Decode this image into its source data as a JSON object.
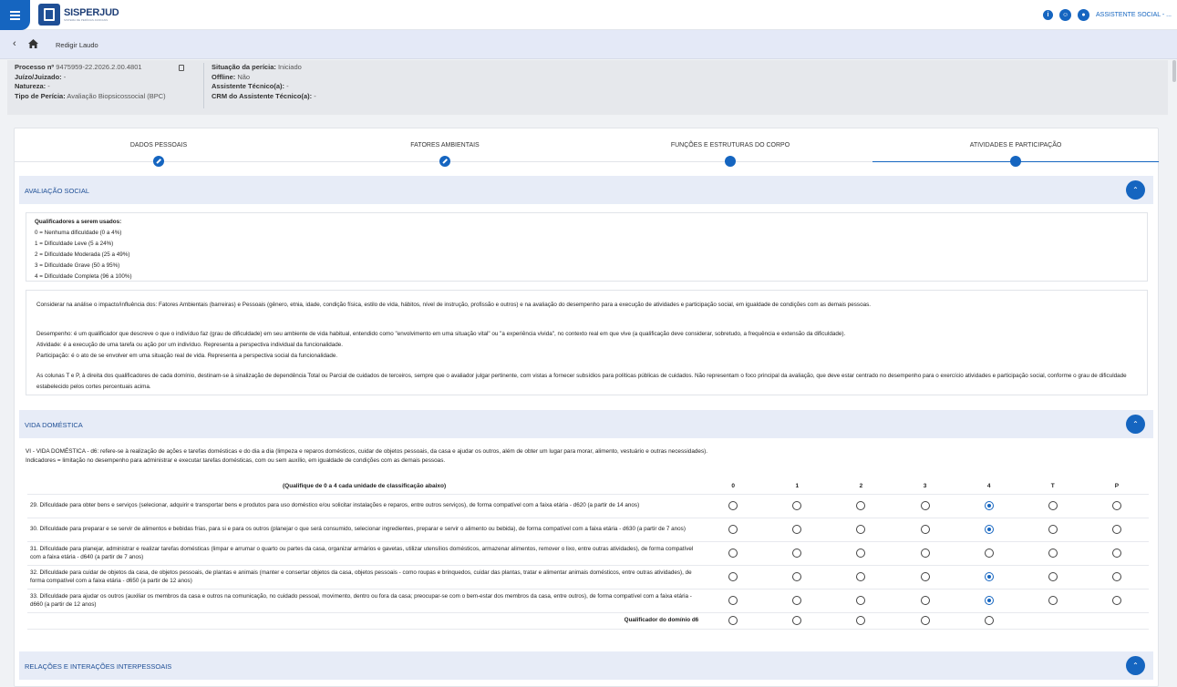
{
  "app": {
    "logo_title": "SISPERJUD",
    "logo_subtitle": "SISTEMA DE PERÍCIAS JUDICIAIS",
    "user": "ASSISTENTE SOCIAL - ..."
  },
  "breadcrumb": {
    "page": "Redigir Laudo"
  },
  "info": {
    "processo_label": "Processo nº",
    "processo_value": "9475959-22.2026.2.00.4801",
    "juizo_label": "Juízo/Juizado:",
    "juizo_value": "-",
    "natureza_label": "Natureza:",
    "natureza_value": "-",
    "tipo_label": "Tipo de Perícia:",
    "tipo_value": "Avaliação Biopsicossocial (BPC)",
    "situacao_label": "Situação da perícia:",
    "situacao_value": "Iniciado",
    "offline_label": "Offline:",
    "offline_value": "Não",
    "assistente_label": "Assistente Técnico(a):",
    "assistente_value": "-",
    "crm_label": "CRM do Assistente Técnico(a):",
    "crm_value": "-"
  },
  "steps": [
    "DADOS PESSOAIS",
    "FATORES AMBIENTAIS",
    "FUNÇÕES E ESTRUTURAS DO CORPO",
    "ATIVIDADES E PARTICIPAÇÃO"
  ],
  "sections": {
    "avaliacao": "AVALIAÇÃO SOCIAL",
    "vida": "VIDA DOMÉSTICA",
    "relacoes": "RELAÇÕES E INTERAÇÕES INTERPESSOAIS"
  },
  "qualificadores": {
    "title": "Qualificadores a serem usados:",
    "items": [
      "0 = Nenhuma dificuldade (0 a 4%)",
      "1 = Dificuldade Leve (5 a 24%)",
      "2 = Dificuldade Moderada (25 a 49%)",
      "3 = Dificuldade Grave (50 a 95%)",
      "4 = Dificuldade Completa (96 a 100%)"
    ]
  },
  "consider": {
    "p1": "Considerar na análise o impacto/influência dos: Fatores Ambientais (barreiras) e Pessoais (gênero, etnia, idade, condição física, estilo de vida, hábitos, nível de instrução, profissão e outros) e na avaliação do desempenho para a execução de atividades e participação social, em igualdade de condições com as demais pessoas.",
    "p2": "Desempenho: é um qualificador que descreve o que o indivíduo faz (grau de dificuldade) em seu ambiente de vida habitual, entendido como \"envolvimento em uma situação vital\" ou \"a experiência vivida\", no contexto real em que vive (a qualificação deve considerar, sobretudo, a frequência e extensão da dificuldade).",
    "p3": "Atividade: é a execução de uma tarefa ou ação por um indivíduo. Representa a perspectiva individual da funcionalidade.",
    "p4": "Participação: é o ato de se envolver em uma situação real de vida. Representa a perspectiva social da funcionalidade.",
    "p5": "As colunas T e P, à direita dos qualificadores de cada domínio, destinam-se à sinalização de dependência Total ou Parcial de cuidados de terceiros, sempre que o avaliador julgar pertinente, com vistas a fornecer subsídios para políticas públicas de cuidados. Não representam o foco principal da avaliação, que deve estar centrado no desempenho para o exercício atividades e participação social, conforme o grau de dificuldade estabelecido pelos cortes percentuais acima."
  },
  "vida": {
    "intro1": "VI - VIDA DOMÉSTICA - d6: refere-se à realização de ações e tarefas domésticas e do dia a dia (limpeza e reparos domésticos, cuidar de objetos pessoais, da casa e ajudar os outros, além de obter um lugar para morar, alimento, vestuário e outras necessidades).",
    "intro2": "Indicadores = limitação no desempenho para administrar e executar tarefas domésticas, com ou sem auxílio, em igualdade de condições com as demais pessoas.",
    "table_header": "(Qualifique de 0 a 4 cada unidade de classificação abaixo)",
    "columns": [
      "0",
      "1",
      "2",
      "3",
      "4",
      "T",
      "P"
    ],
    "rows": [
      {
        "text": "29. Dificuldade para obter bens e serviços (selecionar, adquirir e transportar bens e produtos para uso doméstico e/ou solicitar instalações e reparos, entre outros serviços), de forma compatível com a faixa etária - d620 (a partir de 14 anos)",
        "selected": 4
      },
      {
        "text": "30. Dificuldade para preparar e se servir de alimentos e bebidas frias, para si e para os outros (planejar o que será consumido, selecionar ingredientes, preparar e servir o alimento ou bebida), de forma compatível com a faixa etária - d630 (a partir de 7 anos)",
        "selected": 4
      },
      {
        "text": "31. Dificuldade para planejar, administrar e realizar tarefas domésticas (limpar e arrumar o quarto ou partes da casa, organizar armários e gavetas, utilizar utensílios domésticos, armazenar alimentos, remover o lixo, entre outras atividades), de forma compatível com a faixa etária - d640 (a partir de 7 anos)",
        "selected": -1
      },
      {
        "text": "32. Dificuldade para cuidar de objetos da casa, de objetos pessoais, de plantas e animais (manter e consertar objetos da casa, objetos pessoais - como roupas e brinquedos, cuidar das plantas, tratar e alimentar animais domésticos, entre outras atividades), de forma compatível com a faixa etária - d650 (a partir de 12 anos)",
        "selected": 4
      },
      {
        "text": "33. Dificuldade para ajudar os outros (auxiliar os membros da casa e outros na comunicação, no cuidado pessoal, movimento, dentro ou fora da casa; preocupar-se com o bem-estar dos membros da casa, entre outros), de forma compatível com a faixa etária - d660 (a partir de 12 anos)",
        "selected": 4
      }
    ],
    "total_label": "Qualificador do domínio d6"
  }
}
